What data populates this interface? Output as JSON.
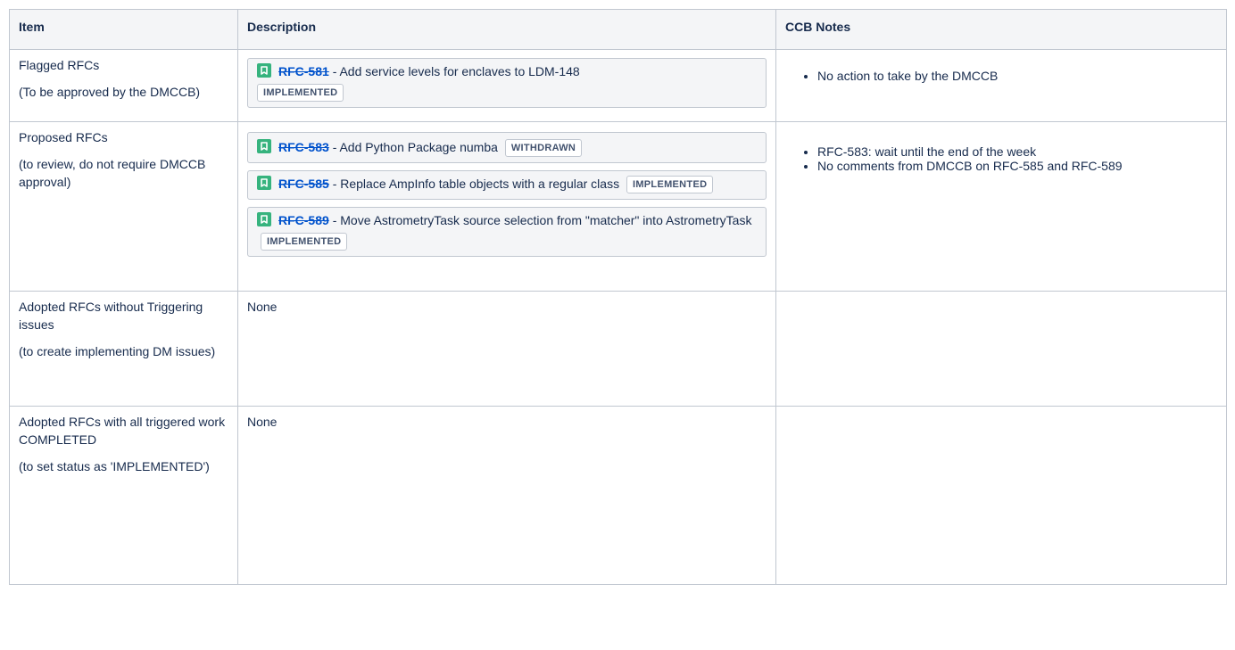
{
  "headers": {
    "item": "Item",
    "description": "Description",
    "notes": "CCB Notes"
  },
  "rows": [
    {
      "item": {
        "title": "Flagged RFCs",
        "subtitle": "(To be approved by the DMCCB)"
      },
      "issues": [
        {
          "key": "RFC-581",
          "summary": "- Add service levels for enclaves to LDM-148",
          "status": "IMPLEMENTED"
        }
      ],
      "notes": [
        "No action to take by the DMCCB"
      ]
    },
    {
      "item": {
        "title": "Proposed RFCs",
        "subtitle": "(to review, do not require DMCCB approval)"
      },
      "issues": [
        {
          "key": "RFC-583",
          "summary": "- Add Python Package numba",
          "status": "WITHDRAWN"
        },
        {
          "key": "RFC-585",
          "summary": "- Replace AmpInfo table objects with a regular class",
          "status": "IMPLEMENTED"
        },
        {
          "key": "RFC-589",
          "summary": "- Move AstrometryTask source selection from \"matcher\" into AstrometryTask",
          "status": "IMPLEMENTED"
        }
      ],
      "notes": [
        "RFC-583: wait until the end of the week",
        "No comments from DMCCB on RFC-585 and RFC-589"
      ]
    },
    {
      "item": {
        "title": "Adopted RFCs without Triggering issues",
        "subtitle": "(to create implementing DM issues)"
      },
      "description": "None"
    },
    {
      "item": {
        "title": "Adopted RFCs with all triggered work COMPLETED",
        "subtitle": "(to set status as 'IMPLEMENTED')"
      },
      "description": "None"
    }
  ],
  "icons": {
    "issue_type": "bookmark-icon",
    "issue_type_color": "#36b37e",
    "link_color": "#0052cc"
  }
}
